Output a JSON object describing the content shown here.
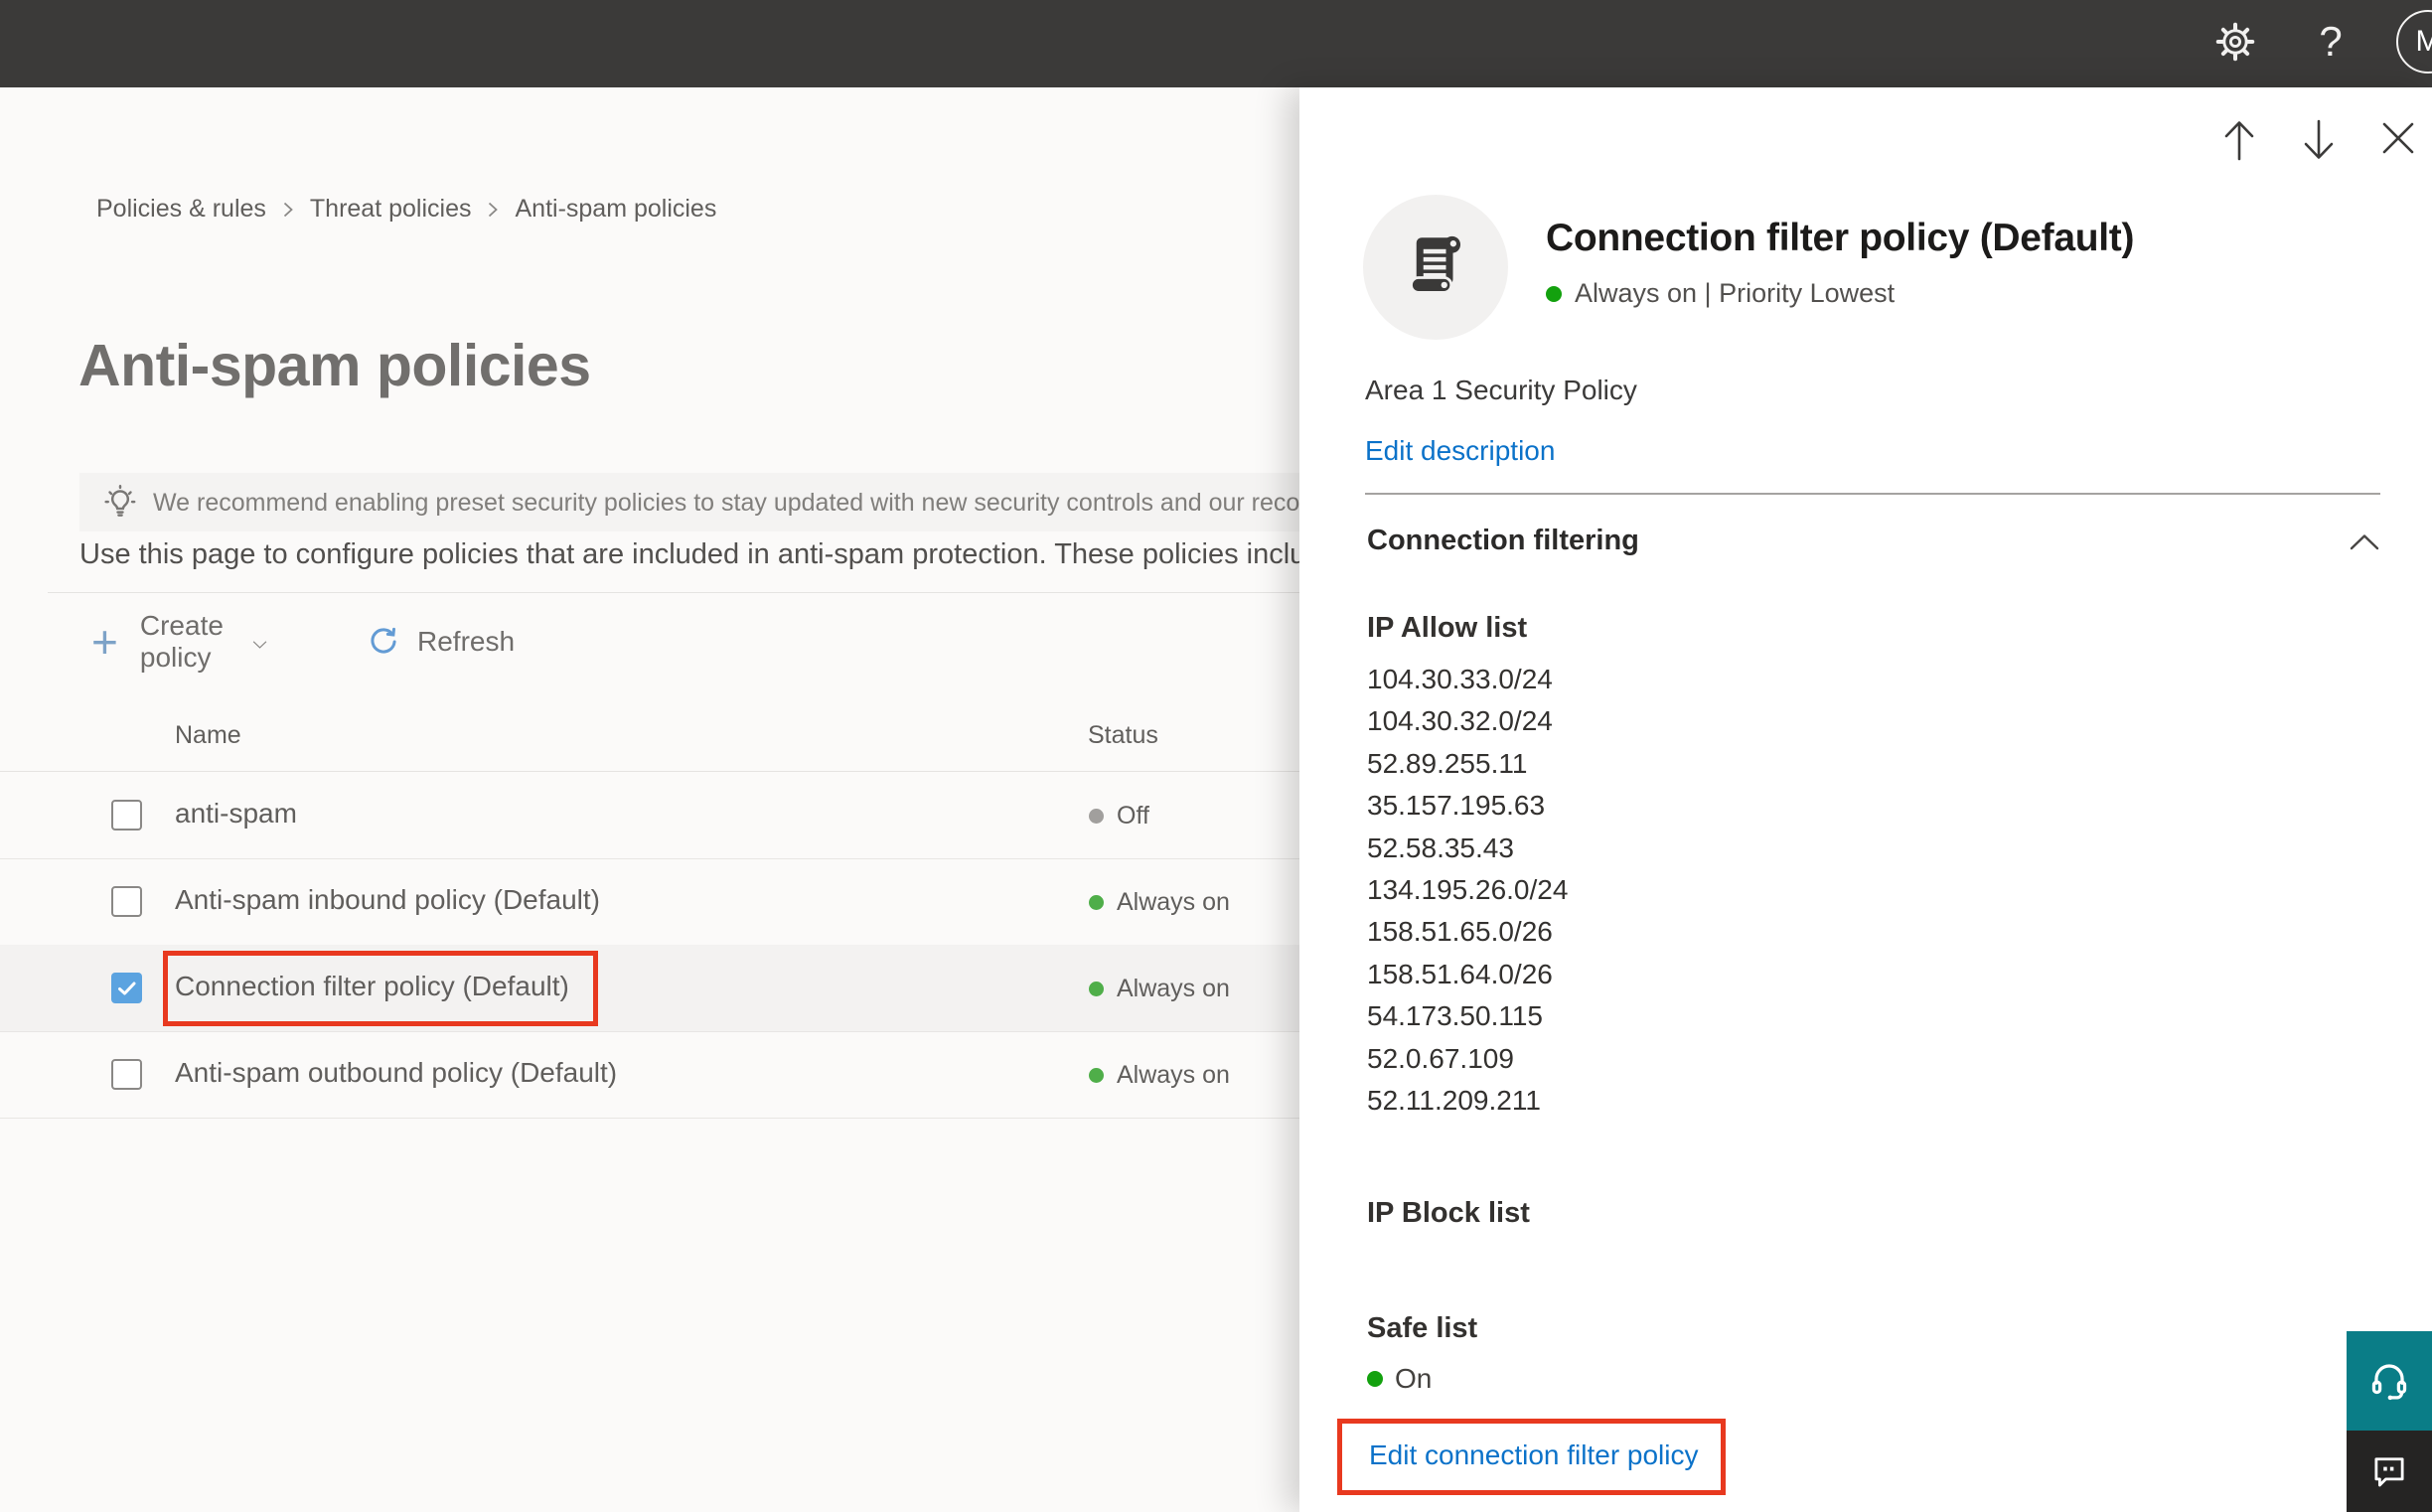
{
  "colors": {
    "topbar_bg": "#3b3a39",
    "link_blue": "#0b72c9",
    "status_on_green": "#4fae49",
    "flyout_green": "#13a10e",
    "status_off_gray": "#a19f9d",
    "annotation_red": "#e8391f",
    "checked_checkbox_blue": "#5ba3e0",
    "support_button_teal": "#0a7d87",
    "feedback_button_dark": "#252423",
    "selected_row_bg": "#f3f2f1"
  },
  "topbar": {
    "help_label": "?",
    "avatar_initial": "M"
  },
  "breadcrumb": {
    "items": [
      "Policies & rules",
      "Threat policies",
      "Anti-spam policies"
    ]
  },
  "page": {
    "title": "Anti-spam policies",
    "banner_text": "We recommend enabling preset security policies to stay updated with new security controls and our recomme",
    "description": "Use this page to configure policies that are included in anti-spam protection. These policies include"
  },
  "toolbar": {
    "create_policy_label": "Create policy",
    "refresh_label": "Refresh"
  },
  "table": {
    "columns": {
      "name": "Name",
      "status": "Status"
    },
    "rows": [
      {
        "name": "anti-spam",
        "status": "Off",
        "checked": false,
        "selected": false
      },
      {
        "name": "Anti-spam inbound policy (Default)",
        "status": "Always on",
        "checked": false,
        "selected": false
      },
      {
        "name": "Connection filter policy (Default)",
        "status": "Always on",
        "checked": true,
        "selected": true,
        "annotated": true
      },
      {
        "name": "Anti-spam outbound policy (Default)",
        "status": "Always on",
        "checked": false,
        "selected": false
      }
    ]
  },
  "flyout": {
    "title": "Connection filter policy (Default)",
    "status_line": "Always on | Priority Lowest",
    "description": "Area 1 Security Policy",
    "edit_description_label": "Edit description",
    "section_title": "Connection filtering",
    "ip_allow": {
      "label": "IP Allow list",
      "items": [
        "104.30.33.0/24",
        "104.30.32.0/24",
        "52.89.255.11",
        "35.157.195.63",
        "52.58.35.43",
        "134.195.26.0/24",
        "158.51.65.0/26",
        "158.51.64.0/26",
        "54.173.50.115",
        "52.0.67.109",
        "52.11.209.211"
      ]
    },
    "ip_block": {
      "label": "IP Block list"
    },
    "safe_list": {
      "label": "Safe list",
      "status": "On"
    },
    "edit_link_label": "Edit connection filter policy"
  }
}
